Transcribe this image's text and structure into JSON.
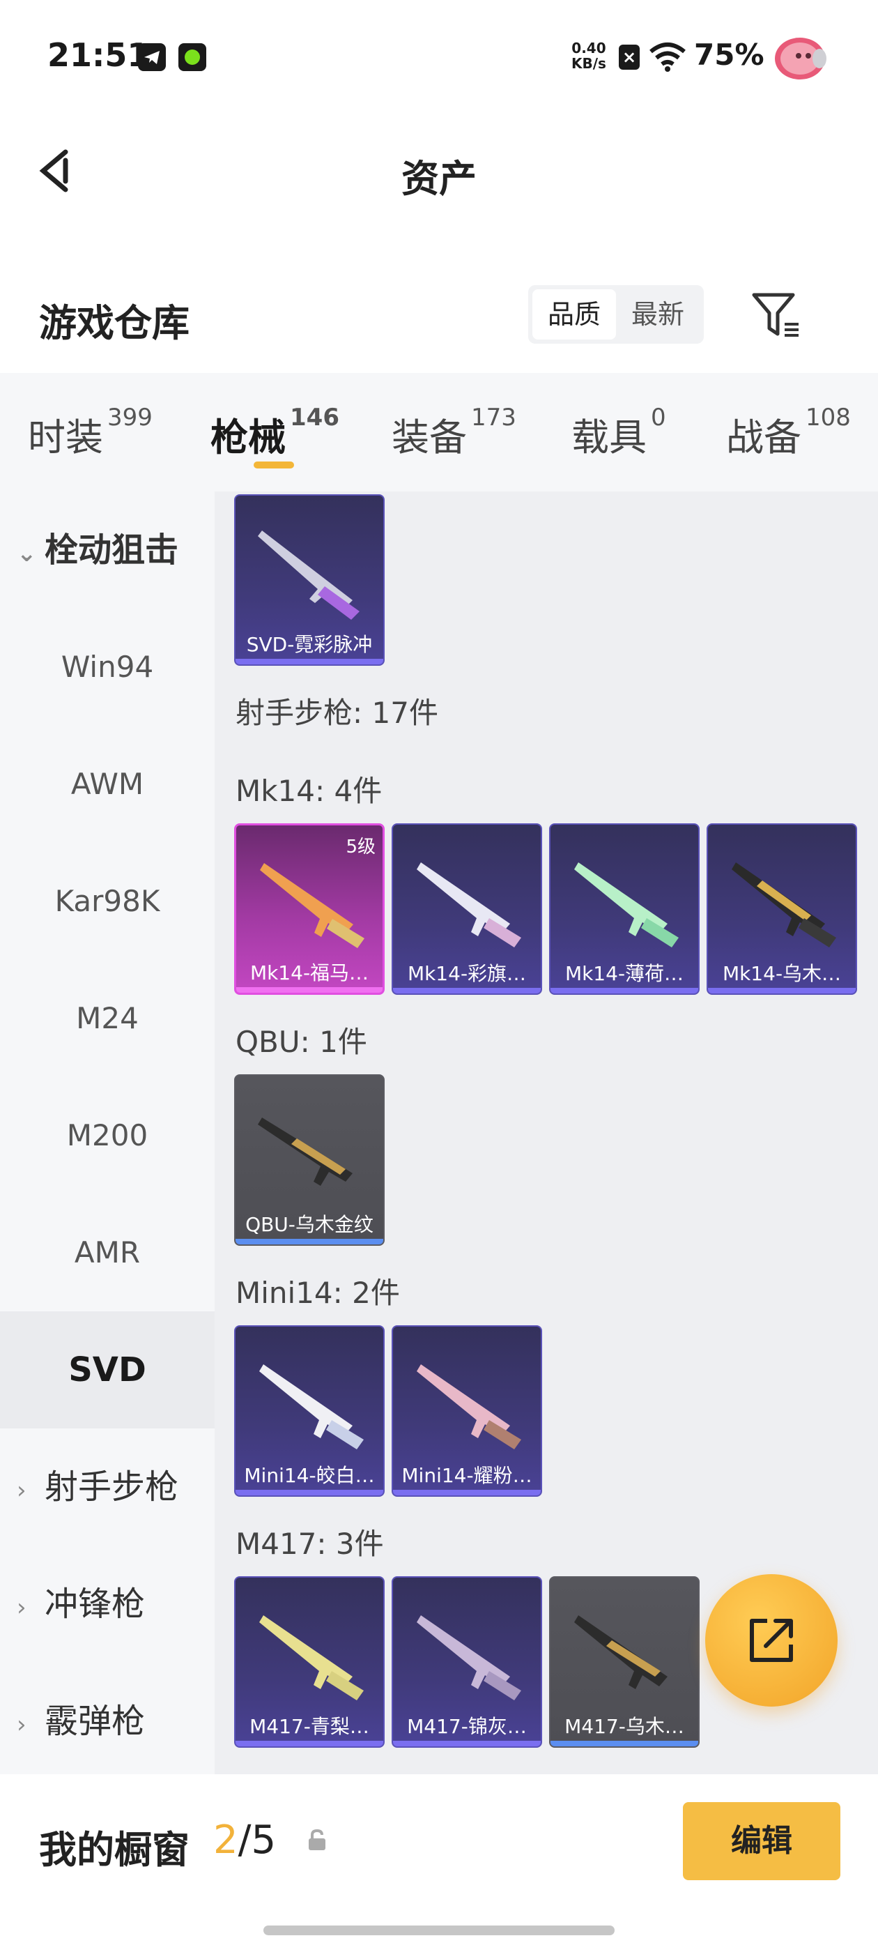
{
  "status_bar": {
    "time": "21:51",
    "net_speed_value": "0.40",
    "net_speed_unit": "KB/s",
    "battery": "75%"
  },
  "header": {
    "title": "资产"
  },
  "warehouse": {
    "title": "游戏仓库",
    "sort_options": [
      "品质",
      "最新"
    ],
    "active_sort": "品质"
  },
  "tabs": [
    {
      "label": "时装",
      "count": "399"
    },
    {
      "label": "枪械",
      "count": "146"
    },
    {
      "label": "装备",
      "count": "173"
    },
    {
      "label": "载具",
      "count": "0"
    },
    {
      "label": "战备",
      "count": "108"
    }
  ],
  "active_tab": "枪械",
  "sidebar": {
    "groups": [
      {
        "label": "栓动狙击",
        "expanded": true
      },
      {
        "label": "射手步枪",
        "expanded": false
      },
      {
        "label": "冲锋枪",
        "expanded": false
      },
      {
        "label": "霰弹枪",
        "expanded": false
      }
    ],
    "items": [
      "Win94",
      "AWM",
      "Kar98K",
      "M24",
      "M200",
      "AMR",
      "SVD"
    ],
    "active_item": "SVD"
  },
  "content": {
    "sections": [
      {
        "title": "",
        "items": [
          {
            "name": "SVD-霓彩脉冲",
            "rarity": "purple"
          }
        ]
      },
      {
        "title": "射手步枪: 17件"
      },
      {
        "title": "Mk14: 4件",
        "items": [
          {
            "name": "Mk14-福马…",
            "rarity": "pink",
            "badge": "5级"
          },
          {
            "name": "Mk14-彩旗…",
            "rarity": "purple"
          },
          {
            "name": "Mk14-薄荷…",
            "rarity": "purple"
          },
          {
            "name": "Mk14-乌木…",
            "rarity": "purple"
          }
        ]
      },
      {
        "title": "QBU: 1件",
        "items": [
          {
            "name": "QBU-乌木金纹",
            "rarity": "gray"
          }
        ]
      },
      {
        "title": "Mini14: 2件",
        "items": [
          {
            "name": "Mini14-皎白…",
            "rarity": "purple"
          },
          {
            "name": "Mini14-耀粉…",
            "rarity": "purple"
          }
        ]
      },
      {
        "title": "M417: 3件",
        "items": [
          {
            "name": "M417-青梨…",
            "rarity": "purple"
          },
          {
            "name": "M417-锦灰…",
            "rarity": "purple"
          },
          {
            "name": "M417-乌木…",
            "rarity": "gray"
          }
        ]
      }
    ]
  },
  "showcase": {
    "title": "我的橱窗",
    "current": "2",
    "total": "/5",
    "edit_label": "编辑"
  },
  "colors": {
    "accent": "#f5bd44",
    "purple_rarity": "#7a6ef0",
    "pink_rarity": "#f070f0"
  }
}
